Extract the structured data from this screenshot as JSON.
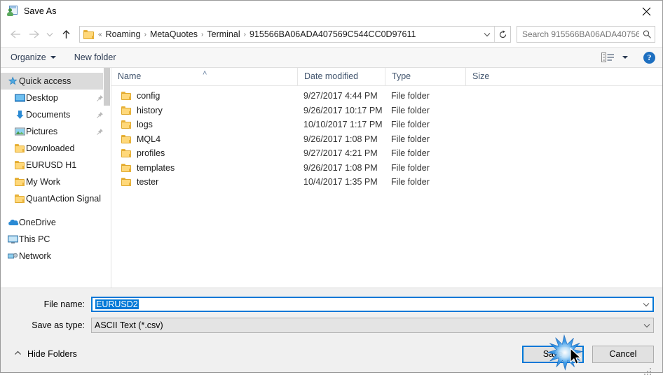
{
  "window": {
    "title": "Save As",
    "title_icon": "save-as-icon",
    "close_icon": "close-icon"
  },
  "nav": {
    "back_icon": "arrow-left-icon",
    "forward_icon": "arrow-right-icon",
    "recent_icon": "chevron-down-icon",
    "up_icon": "arrow-up-icon",
    "address": {
      "folder_icon": "folder-icon",
      "prefix": "«",
      "crumbs": [
        "Roaming",
        "MetaQuotes",
        "Terminal",
        "915566BA06ADA407569C544CC0D97611"
      ],
      "separator": "›",
      "dropdown_icon": "chevron-down-icon",
      "refresh_icon": "refresh-icon"
    },
    "search": {
      "placeholder": "Search 915566BA06ADA40756...",
      "icon": "search-icon"
    }
  },
  "toolbar": {
    "organize_label": "Organize",
    "new_folder_label": "New folder",
    "view_icon": "view-list-icon",
    "view_caret_icon": "chevron-down-icon",
    "help_label": "?",
    "help_icon": "help-icon"
  },
  "sidebar": {
    "items": [
      {
        "label": "Quick access",
        "icon": "star-pin-icon",
        "selected": true,
        "indent": false,
        "pinned": false
      },
      {
        "label": "Desktop",
        "icon": "desktop-icon",
        "selected": false,
        "indent": true,
        "pinned": true
      },
      {
        "label": "Documents",
        "icon": "documents-icon",
        "selected": false,
        "indent": true,
        "pinned": true
      },
      {
        "label": "Pictures",
        "icon": "pictures-icon",
        "selected": false,
        "indent": true,
        "pinned": true
      },
      {
        "label": "Downloaded",
        "icon": "folder-icon",
        "selected": false,
        "indent": true,
        "pinned": false
      },
      {
        "label": "EURUSD H1",
        "icon": "folder-icon",
        "selected": false,
        "indent": true,
        "pinned": false
      },
      {
        "label": "My Work",
        "icon": "folder-icon",
        "selected": false,
        "indent": true,
        "pinned": false
      },
      {
        "label": "QuantAction Signal",
        "icon": "folder-icon",
        "selected": false,
        "indent": true,
        "pinned": false
      }
    ],
    "roots": [
      {
        "label": "OneDrive",
        "icon": "onedrive-icon"
      },
      {
        "label": "This PC",
        "icon": "this-pc-icon"
      },
      {
        "label": "Network",
        "icon": "network-icon"
      }
    ]
  },
  "filelist": {
    "columns": [
      "Name",
      "Date modified",
      "Type",
      "Size"
    ],
    "sort_column": "Name",
    "sort_indicator": "˄",
    "rows": [
      {
        "name": "config",
        "date": "9/27/2017 4:44 PM",
        "type": "File folder",
        "size": ""
      },
      {
        "name": "history",
        "date": "9/26/2017 10:17 PM",
        "type": "File folder",
        "size": ""
      },
      {
        "name": "logs",
        "date": "10/10/2017 1:17 PM",
        "type": "File folder",
        "size": ""
      },
      {
        "name": "MQL4",
        "date": "9/26/2017 1:08 PM",
        "type": "File folder",
        "size": ""
      },
      {
        "name": "profiles",
        "date": "9/27/2017 4:21 PM",
        "type": "File folder",
        "size": ""
      },
      {
        "name": "templates",
        "date": "9/26/2017 1:08 PM",
        "type": "File folder",
        "size": ""
      },
      {
        "name": "tester",
        "date": "10/4/2017 1:35 PM",
        "type": "File folder",
        "size": ""
      }
    ]
  },
  "form": {
    "filename_label": "File name:",
    "filename_value": "EURUSD2",
    "filename_selected": true,
    "filetype_label": "Save as type:",
    "filetype_value": "ASCII Text (*.csv)",
    "caret_icon": "chevron-down-icon"
  },
  "actions": {
    "hide_folders_label": "Hide Folders",
    "hide_folders_icon": "chevron-up-icon",
    "save_label": "Save",
    "cancel_label": "Cancel"
  },
  "colors": {
    "accent": "#0078d7",
    "folder": "#ffd87a",
    "header_text": "#42556e",
    "selection": "#dbdbdb"
  }
}
